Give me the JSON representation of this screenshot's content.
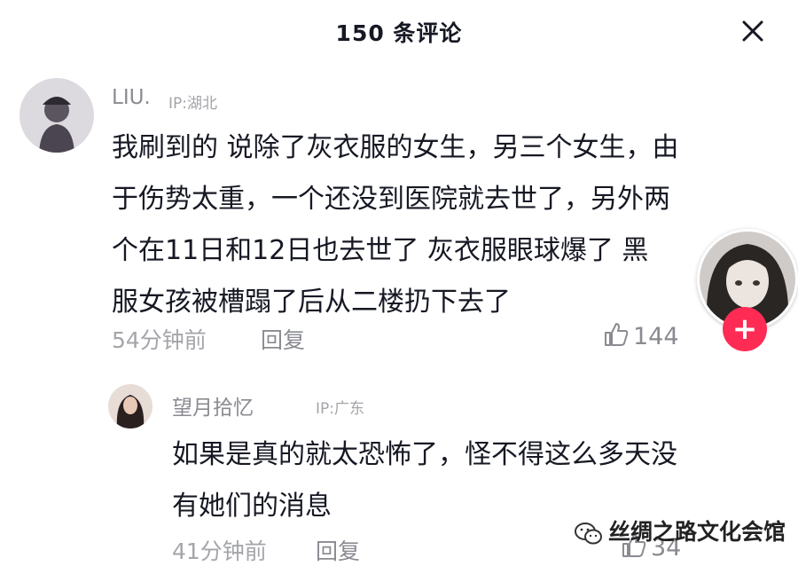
{
  "header": {
    "title": "150 条评论",
    "close_icon": "close-icon"
  },
  "comments": [
    {
      "username": "LIU.",
      "ip": "IP:湖北",
      "lines": [
        "我刷到的 说除了灰衣服的女生，另三个女生，由",
        "于伤势太重，一个还没到医院就去世了，另外两",
        "个在11日和12日也去世了 灰衣服眼球爆了 黑",
        "服女孩被槽蹋了后从二楼扔下去了"
      ],
      "time": "54分钟前",
      "reply_label": "回复",
      "likes": "144",
      "avatar_icon": "avatar"
    },
    {
      "username": "望月拾忆",
      "ip": "IP:广东",
      "lines": [
        "如果是真的就太恐怖了，怪不得这么多天没",
        "有她们的消息"
      ],
      "time": "41分钟前",
      "reply_label": "回复",
      "likes": "34",
      "avatar_icon": "avatar"
    }
  ],
  "creator": {
    "follow_label": "+",
    "avatar_icon": "creator-avatar"
  },
  "watermark": {
    "text": "丝绸之路文化会馆",
    "icon": "wechat-icon"
  },
  "colors": {
    "accent": "#fe2c55",
    "text": "#161823",
    "muted": "#a4a5aa"
  }
}
